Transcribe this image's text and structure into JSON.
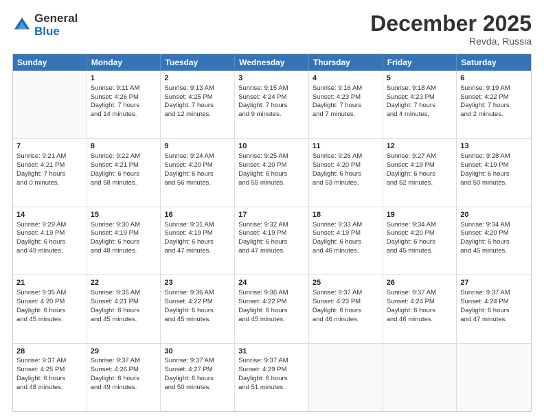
{
  "header": {
    "logo_general": "General",
    "logo_blue": "Blue",
    "month_title": "December 2025",
    "location": "Revda, Russia"
  },
  "days_of_week": [
    "Sunday",
    "Monday",
    "Tuesday",
    "Wednesday",
    "Thursday",
    "Friday",
    "Saturday"
  ],
  "weeks": [
    [
      {
        "day": "",
        "empty": true,
        "lines": []
      },
      {
        "day": "1",
        "lines": [
          "Sunrise: 9:11 AM",
          "Sunset: 4:26 PM",
          "Daylight: 7 hours",
          "and 14 minutes."
        ]
      },
      {
        "day": "2",
        "lines": [
          "Sunrise: 9:13 AM",
          "Sunset: 4:25 PM",
          "Daylight: 7 hours",
          "and 12 minutes."
        ]
      },
      {
        "day": "3",
        "lines": [
          "Sunrise: 9:15 AM",
          "Sunset: 4:24 PM",
          "Daylight: 7 hours",
          "and 9 minutes."
        ]
      },
      {
        "day": "4",
        "lines": [
          "Sunrise: 9:16 AM",
          "Sunset: 4:23 PM",
          "Daylight: 7 hours",
          "and 7 minutes."
        ]
      },
      {
        "day": "5",
        "lines": [
          "Sunrise: 9:18 AM",
          "Sunset: 4:23 PM",
          "Daylight: 7 hours",
          "and 4 minutes."
        ]
      },
      {
        "day": "6",
        "lines": [
          "Sunrise: 9:19 AM",
          "Sunset: 4:22 PM",
          "Daylight: 7 hours",
          "and 2 minutes."
        ]
      }
    ],
    [
      {
        "day": "7",
        "lines": [
          "Sunrise: 9:21 AM",
          "Sunset: 4:21 PM",
          "Daylight: 7 hours",
          "and 0 minutes."
        ]
      },
      {
        "day": "8",
        "lines": [
          "Sunrise: 9:22 AM",
          "Sunset: 4:21 PM",
          "Daylight: 6 hours",
          "and 58 minutes."
        ]
      },
      {
        "day": "9",
        "lines": [
          "Sunrise: 9:24 AM",
          "Sunset: 4:20 PM",
          "Daylight: 6 hours",
          "and 56 minutes."
        ]
      },
      {
        "day": "10",
        "lines": [
          "Sunrise: 9:25 AM",
          "Sunset: 4:20 PM",
          "Daylight: 6 hours",
          "and 55 minutes."
        ]
      },
      {
        "day": "11",
        "lines": [
          "Sunrise: 9:26 AM",
          "Sunset: 4:20 PM",
          "Daylight: 6 hours",
          "and 53 minutes."
        ]
      },
      {
        "day": "12",
        "lines": [
          "Sunrise: 9:27 AM",
          "Sunset: 4:19 PM",
          "Daylight: 6 hours",
          "and 52 minutes."
        ]
      },
      {
        "day": "13",
        "lines": [
          "Sunrise: 9:28 AM",
          "Sunset: 4:19 PM",
          "Daylight: 6 hours",
          "and 50 minutes."
        ]
      }
    ],
    [
      {
        "day": "14",
        "lines": [
          "Sunrise: 9:29 AM",
          "Sunset: 4:19 PM",
          "Daylight: 6 hours",
          "and 49 minutes."
        ]
      },
      {
        "day": "15",
        "lines": [
          "Sunrise: 9:30 AM",
          "Sunset: 4:19 PM",
          "Daylight: 6 hours",
          "and 48 minutes."
        ]
      },
      {
        "day": "16",
        "lines": [
          "Sunrise: 9:31 AM",
          "Sunset: 4:19 PM",
          "Daylight: 6 hours",
          "and 47 minutes."
        ]
      },
      {
        "day": "17",
        "lines": [
          "Sunrise: 9:32 AM",
          "Sunset: 4:19 PM",
          "Daylight: 6 hours",
          "and 47 minutes."
        ]
      },
      {
        "day": "18",
        "lines": [
          "Sunrise: 9:33 AM",
          "Sunset: 4:19 PM",
          "Daylight: 6 hours",
          "and 46 minutes."
        ]
      },
      {
        "day": "19",
        "lines": [
          "Sunrise: 9:34 AM",
          "Sunset: 4:20 PM",
          "Daylight: 6 hours",
          "and 45 minutes."
        ]
      },
      {
        "day": "20",
        "lines": [
          "Sunrise: 9:34 AM",
          "Sunset: 4:20 PM",
          "Daylight: 6 hours",
          "and 45 minutes."
        ]
      }
    ],
    [
      {
        "day": "21",
        "lines": [
          "Sunrise: 9:35 AM",
          "Sunset: 4:20 PM",
          "Daylight: 6 hours",
          "and 45 minutes."
        ]
      },
      {
        "day": "22",
        "lines": [
          "Sunrise: 9:35 AM",
          "Sunset: 4:21 PM",
          "Daylight: 6 hours",
          "and 45 minutes."
        ]
      },
      {
        "day": "23",
        "lines": [
          "Sunrise: 9:36 AM",
          "Sunset: 4:22 PM",
          "Daylight: 6 hours",
          "and 45 minutes."
        ]
      },
      {
        "day": "24",
        "lines": [
          "Sunrise: 9:36 AM",
          "Sunset: 4:22 PM",
          "Daylight: 6 hours",
          "and 45 minutes."
        ]
      },
      {
        "day": "25",
        "lines": [
          "Sunrise: 9:37 AM",
          "Sunset: 4:23 PM",
          "Daylight: 6 hours",
          "and 46 minutes."
        ]
      },
      {
        "day": "26",
        "lines": [
          "Sunrise: 9:37 AM",
          "Sunset: 4:24 PM",
          "Daylight: 6 hours",
          "and 46 minutes."
        ]
      },
      {
        "day": "27",
        "lines": [
          "Sunrise: 9:37 AM",
          "Sunset: 4:24 PM",
          "Daylight: 6 hours",
          "and 47 minutes."
        ]
      }
    ],
    [
      {
        "day": "28",
        "lines": [
          "Sunrise: 9:37 AM",
          "Sunset: 4:25 PM",
          "Daylight: 6 hours",
          "and 48 minutes."
        ]
      },
      {
        "day": "29",
        "lines": [
          "Sunrise: 9:37 AM",
          "Sunset: 4:26 PM",
          "Daylight: 6 hours",
          "and 49 minutes."
        ]
      },
      {
        "day": "30",
        "lines": [
          "Sunrise: 9:37 AM",
          "Sunset: 4:27 PM",
          "Daylight: 6 hours",
          "and 50 minutes."
        ]
      },
      {
        "day": "31",
        "lines": [
          "Sunrise: 9:37 AM",
          "Sunset: 4:29 PM",
          "Daylight: 6 hours",
          "and 51 minutes."
        ]
      },
      {
        "day": "",
        "empty": true,
        "lines": []
      },
      {
        "day": "",
        "empty": true,
        "lines": []
      },
      {
        "day": "",
        "empty": true,
        "lines": []
      }
    ]
  ]
}
